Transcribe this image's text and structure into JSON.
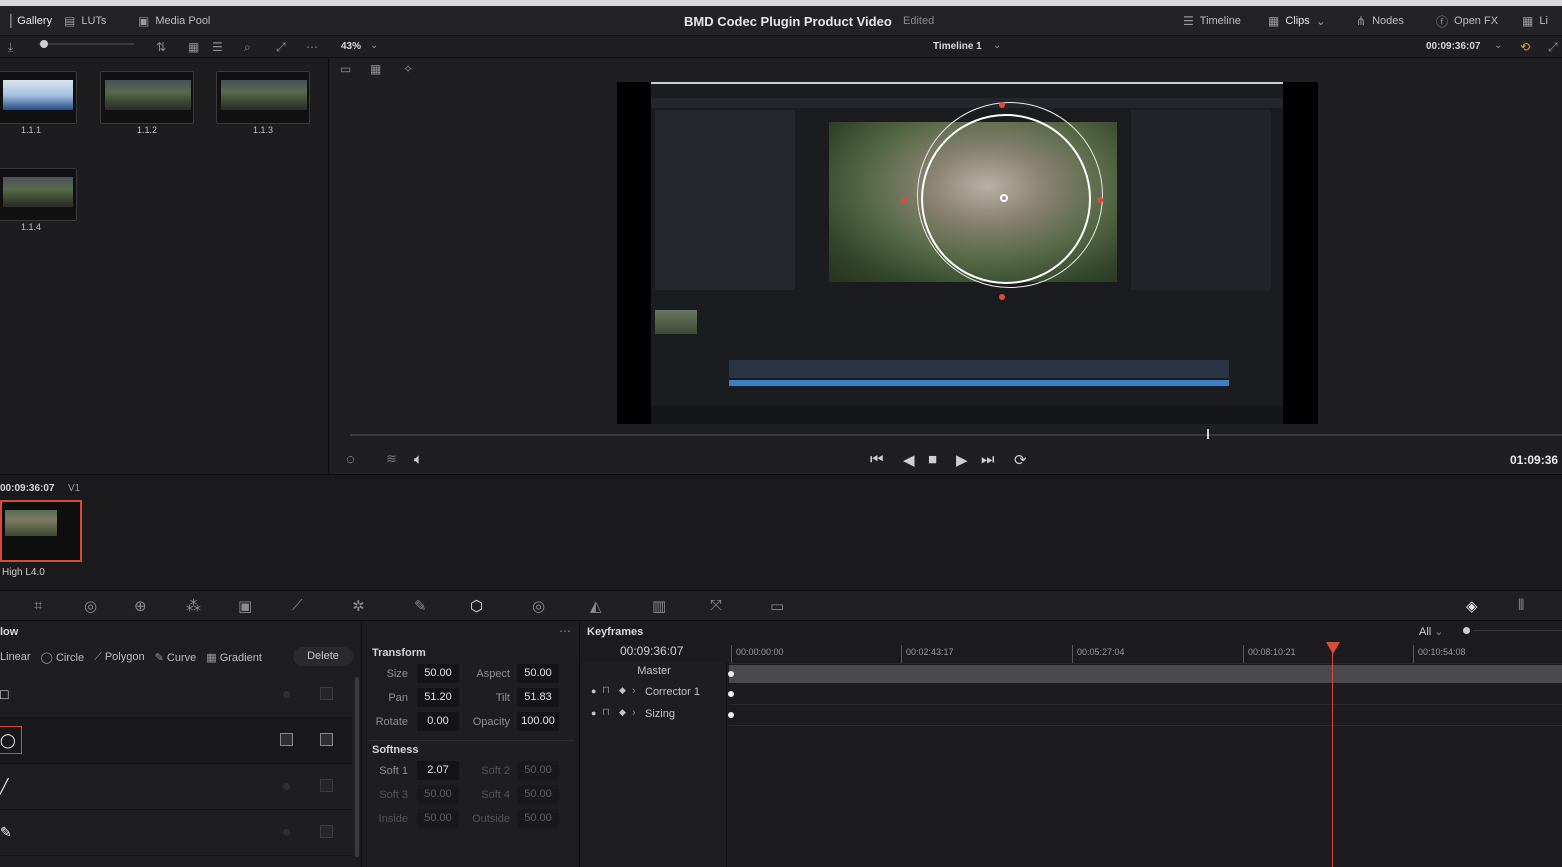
{
  "header": {
    "gallery_label": "Gallery",
    "luts_label": "LUTs",
    "media_pool_label": "Media Pool",
    "project_title": "BMD Codec Plugin Product Video",
    "project_status": "Edited",
    "timeline_label": "Timeline",
    "clips_label": "Clips",
    "nodes_label": "Nodes",
    "openfx_label": "Open FX",
    "lightbox_label": "Li"
  },
  "toolbar": {
    "zoom": "43%",
    "timeline_name": "Timeline 1",
    "timecode": "00:09:36:07"
  },
  "gallery": {
    "stills": [
      {
        "label": "1.1.1"
      },
      {
        "label": "1.1.2"
      },
      {
        "label": "1.1.3"
      },
      {
        "label": "1.1.4"
      }
    ]
  },
  "viewer": {
    "timecode": "01:09:36"
  },
  "clips": {
    "timecode": "00:09:36:07",
    "track": "V1",
    "clip_name": "High L4.0"
  },
  "window_panel": {
    "title": "low",
    "shapes": [
      "Linear",
      "Circle",
      "Polygon",
      "Curve",
      "Gradient"
    ],
    "delete_label": "Delete"
  },
  "transform": {
    "title": "Transform",
    "size_label": "Size",
    "size": "50.00",
    "aspect_label": "Aspect",
    "aspect": "50.00",
    "pan_label": "Pan",
    "pan": "51.20",
    "tilt_label": "Tilt",
    "tilt": "51.83",
    "rotate_label": "Rotate",
    "rotate": "0.00",
    "opacity_label": "Opacity",
    "opacity": "100.00",
    "softness_title": "Softness",
    "soft1_label": "Soft 1",
    "soft1": "2.07",
    "soft2_label": "Soft 2",
    "soft2": "50.00",
    "soft3_label": "Soft 3",
    "soft3": "50.00",
    "soft4_label": "Soft 4",
    "soft4": "50.00",
    "inside_label": "Inside",
    "inside": "50.00",
    "outside_label": "Outside",
    "outside": "50.00"
  },
  "keyframes": {
    "title": "Keyframes",
    "filter": "All",
    "timecode": "00:09:36:07",
    "master": "Master",
    "tracks": [
      "Corrector 1",
      "Sizing"
    ],
    "ruler": [
      "00:00:00:00",
      "00:02:43:17",
      "00:05:27:04",
      "00:08:10:21",
      "00:10:54:08"
    ]
  },
  "colors": {
    "accent_red": "#d64a3b",
    "clip_blue": "#3c7fc4"
  }
}
